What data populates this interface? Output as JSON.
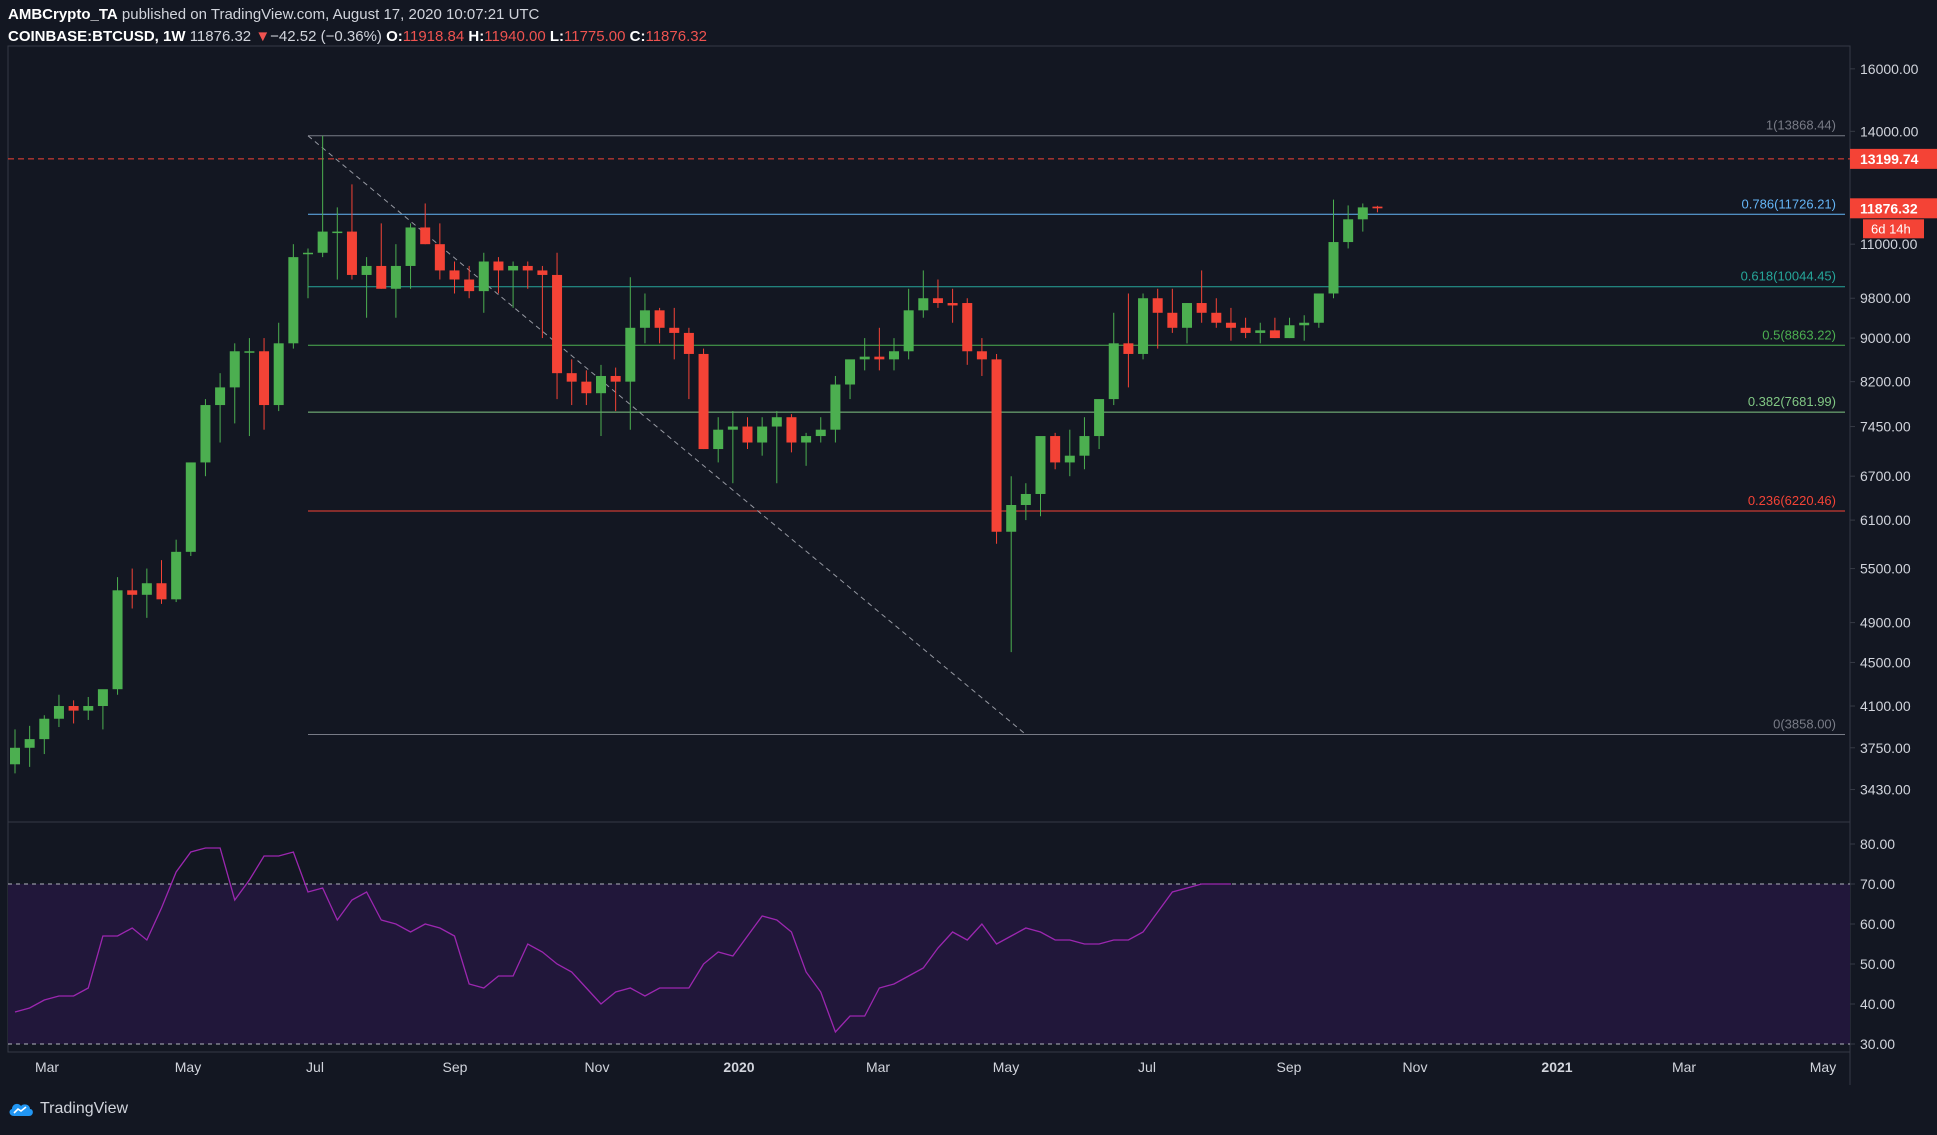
{
  "header": {
    "author": "AMBCrypto_TA",
    "published": "published on TradingView.com, August 17, 2020 10:07:21 UTC",
    "symbol": "COINBASE:BTCUSD, 1W",
    "last": "11876.32",
    "change_arrow": "▼",
    "change": "−42.52 (−0.36%)",
    "o_label": "O:",
    "o": "11918.84",
    "h_label": "H:",
    "h": "11940.00",
    "l_label": "L:",
    "l": "11775.00",
    "c_label": "C:",
    "c": "11876.32"
  },
  "footer": {
    "brand": "TradingView",
    "logo_icon": "tradingview-cloud-icon"
  },
  "colors": {
    "bg": "#131722",
    "up": "#4caf50",
    "down": "#f44336",
    "grid": "#363a45",
    "rsi": "#9c27b0",
    "rsi_band": "#21173a",
    "text": "#d1d4dc"
  },
  "chart_data": [
    {
      "type": "candlestick",
      "scale": "log",
      "ylim": [
        3200,
        16800
      ],
      "y_ticks": [
        "16000.00",
        "14000.00",
        "11000.00",
        "9800.00",
        "9000.00",
        "8200.00",
        "7450.00",
        "6700.00",
        "6100.00",
        "5500.00",
        "4900.00",
        "4500.00",
        "4100.00",
        "3750.00",
        "3430.00"
      ],
      "y_tick_values": [
        16000,
        14000,
        11000,
        9800,
        9000,
        8200,
        7450,
        6700,
        6100,
        5500,
        4900,
        4500,
        4100,
        3750,
        3430
      ],
      "x_ticks": [
        "Mar",
        "May",
        "Jul",
        "Sep",
        "Nov",
        "2020",
        "Mar",
        "May",
        "Jul",
        "Sep",
        "Nov",
        "2021",
        "Mar",
        "May"
      ],
      "candles": [
        [
          3620,
          3900,
          3550,
          3750
        ],
        [
          3750,
          3930,
          3600,
          3820
        ],
        [
          3820,
          4020,
          3700,
          3990
        ],
        [
          3990,
          4200,
          3920,
          4100
        ],
        [
          4100,
          4150,
          3950,
          4060
        ],
        [
          4060,
          4180,
          3980,
          4100
        ],
        [
          4100,
          4200,
          3900,
          4250
        ],
        [
          4250,
          5400,
          4200,
          5250
        ],
        [
          5250,
          5500,
          5050,
          5200
        ],
        [
          5200,
          5500,
          4950,
          5330
        ],
        [
          5330,
          5600,
          5100,
          5150
        ],
        [
          5150,
          5850,
          5120,
          5700
        ],
        [
          5700,
          6600,
          5650,
          6900
        ],
        [
          6900,
          7900,
          6700,
          7800
        ],
        [
          7800,
          8350,
          7200,
          8100
        ],
        [
          8100,
          8900,
          7500,
          8750
        ],
        [
          8750,
          9000,
          7300,
          8750
        ],
        [
          8750,
          9000,
          7400,
          7800
        ],
        [
          7800,
          9300,
          7700,
          8900
        ],
        [
          8900,
          11000,
          8800,
          10700
        ],
        [
          10800,
          10900,
          9800,
          10800
        ],
        [
          10800,
          13868,
          10700,
          11300
        ],
        [
          11300,
          11900,
          10200,
          11300
        ],
        [
          11300,
          12500,
          10200,
          10300
        ],
        [
          10300,
          10700,
          9400,
          10500
        ],
        [
          10500,
          11500,
          10000,
          10000
        ],
        [
          10000,
          11000,
          9400,
          10500
        ],
        [
          10500,
          11500,
          10000,
          11400
        ],
        [
          11400,
          12000,
          11000,
          11000
        ],
        [
          11000,
          11500,
          10200,
          10400
        ],
        [
          10400,
          10600,
          9900,
          10200
        ],
        [
          10200,
          10500,
          9800,
          9950
        ],
        [
          9950,
          10800,
          9500,
          10600
        ],
        [
          10600,
          10700,
          9900,
          10400
        ],
        [
          10400,
          10600,
          9600,
          10500
        ],
        [
          10500,
          10600,
          10000,
          10400
        ],
        [
          10400,
          10500,
          9000,
          10300
        ],
        [
          10300,
          10800,
          7900,
          8350
        ],
        [
          8350,
          8600,
          7800,
          8200
        ],
        [
          8200,
          8400,
          7800,
          8000
        ],
        [
          8000,
          8500,
          7300,
          8300
        ],
        [
          8300,
          8450,
          7700,
          8200
        ],
        [
          8200,
          10250,
          7400,
          9200
        ],
        [
          9200,
          9900,
          8900,
          9550
        ],
        [
          9550,
          9600,
          8900,
          9200
        ],
        [
          9200,
          9600,
          8600,
          9100
        ],
        [
          9100,
          9200,
          7900,
          8700
        ],
        [
          8700,
          8800,
          7100,
          7100
        ],
        [
          7100,
          7600,
          6900,
          7400
        ],
        [
          7400,
          7700,
          6600,
          7450
        ],
        [
          7450,
          7600,
          7100,
          7200
        ],
        [
          7200,
          7600,
          7000,
          7450
        ],
        [
          7450,
          7700,
          6600,
          7600
        ],
        [
          7600,
          7650,
          7050,
          7200
        ],
        [
          7200,
          7350,
          6850,
          7300
        ],
        [
          7300,
          7600,
          7200,
          7400
        ],
        [
          7400,
          8300,
          7200,
          8150
        ],
        [
          8150,
          8450,
          7900,
          8600
        ],
        [
          8600,
          9000,
          8400,
          8650
        ],
        [
          8650,
          9200,
          8400,
          8600
        ],
        [
          8600,
          9000,
          8400,
          8750
        ],
        [
          8750,
          10000,
          8600,
          9550
        ],
        [
          9550,
          10400,
          9400,
          9800
        ],
        [
          9800,
          10200,
          9600,
          9700
        ],
        [
          9700,
          10000,
          9300,
          9650
        ],
        [
          9700,
          9800,
          8500,
          8750
        ],
        [
          8750,
          9000,
          8300,
          8600
        ],
        [
          8600,
          8700,
          5800,
          5950
        ],
        [
          5950,
          6700,
          4600,
          6300
        ],
        [
          6300,
          6600,
          6100,
          6450
        ],
        [
          6450,
          7200,
          6150,
          7300
        ],
        [
          7300,
          7350,
          6800,
          6900
        ],
        [
          6900,
          7400,
          6700,
          7000
        ],
        [
          7000,
          7600,
          6800,
          7300
        ],
        [
          7300,
          7750,
          7100,
          7900
        ],
        [
          7900,
          9500,
          7800,
          8900
        ],
        [
          8900,
          9900,
          8100,
          8700
        ],
        [
          8700,
          9900,
          8600,
          9800
        ],
        [
          9800,
          10000,
          8800,
          9500
        ],
        [
          9500,
          10000,
          9100,
          9200
        ],
        [
          9200,
          9700,
          8900,
          9700
        ],
        [
          9700,
          10400,
          9300,
          9500
        ],
        [
          9500,
          9800,
          9200,
          9300
        ],
        [
          9300,
          9600,
          8950,
          9200
        ],
        [
          9200,
          9400,
          9000,
          9100
        ],
        [
          9100,
          9300,
          8900,
          9150
        ],
        [
          9150,
          9400,
          9000,
          9000
        ],
        [
          9000,
          9400,
          9000,
          9250
        ],
        [
          9250,
          9450,
          8950,
          9300
        ],
        [
          9300,
          9800,
          9200,
          9900
        ],
        [
          9900,
          12100,
          9800,
          11050
        ],
        [
          11050,
          11950,
          10900,
          11600
        ],
        [
          11600,
          12000,
          11300,
          11900
        ],
        [
          11918.84,
          11940,
          11775,
          11876.32
        ]
      ],
      "fib_levels": [
        {
          "ratio": "1",
          "value": 13868.44,
          "label": "1(13868.44)",
          "color": "#787b86"
        },
        {
          "ratio": "0.786",
          "value": 11726.21,
          "label": "0.786(11726.21)",
          "color": "#64b5f6"
        },
        {
          "ratio": "0.618",
          "value": 10044.45,
          "label": "0.618(10044.45)",
          "color": "#26a69a"
        },
        {
          "ratio": "0.5",
          "value": 8863.22,
          "label": "0.5(8863.22)",
          "color": "#4caf50"
        },
        {
          "ratio": "0.382",
          "value": 7681.99,
          "label": "0.382(7681.99)",
          "color": "#81c784"
        },
        {
          "ratio": "0.236",
          "value": 6220.46,
          "label": "0.236(6220.46)",
          "color": "#f44336"
        },
        {
          "ratio": "0",
          "value": 3858,
          "label": "0(3858.00)",
          "color": "#787b86"
        }
      ],
      "fib_start_index": 20,
      "fib_end_index": 69,
      "resistance_line": {
        "value": 13199.74,
        "label": "13199.74",
        "color": "#f44336"
      },
      "last_price": {
        "value": 11876.32,
        "label": "11876.32",
        "countdown": "6d 14h"
      }
    },
    {
      "type": "line",
      "name": "RSI",
      "ylim": [
        28,
        85
      ],
      "y_ticks": [
        "80.00",
        "70.00",
        "60.00",
        "50.00",
        "40.00",
        "30.00"
      ],
      "y_tick_values": [
        80,
        70,
        60,
        50,
        40,
        30
      ],
      "bands": [
        70,
        30
      ],
      "values": [
        38,
        39,
        41,
        42,
        42,
        44,
        57,
        57,
        59,
        56,
        64,
        73,
        78,
        79,
        79,
        66,
        71,
        77,
        77,
        78,
        68,
        69,
        61,
        66,
        68,
        61,
        60,
        58,
        60,
        59,
        57,
        45,
        44,
        47,
        47,
        55,
        53,
        50,
        48,
        44,
        40,
        43,
        44,
        42,
        44,
        44,
        44,
        50,
        53,
        52,
        57,
        62,
        61,
        58,
        48,
        43,
        33,
        37,
        37,
        44,
        45,
        47,
        49,
        54,
        58,
        56,
        60,
        55,
        57,
        59,
        58,
        56,
        56,
        55,
        55,
        56,
        56,
        58,
        63,
        68,
        69,
        70,
        70,
        70
      ]
    }
  ]
}
